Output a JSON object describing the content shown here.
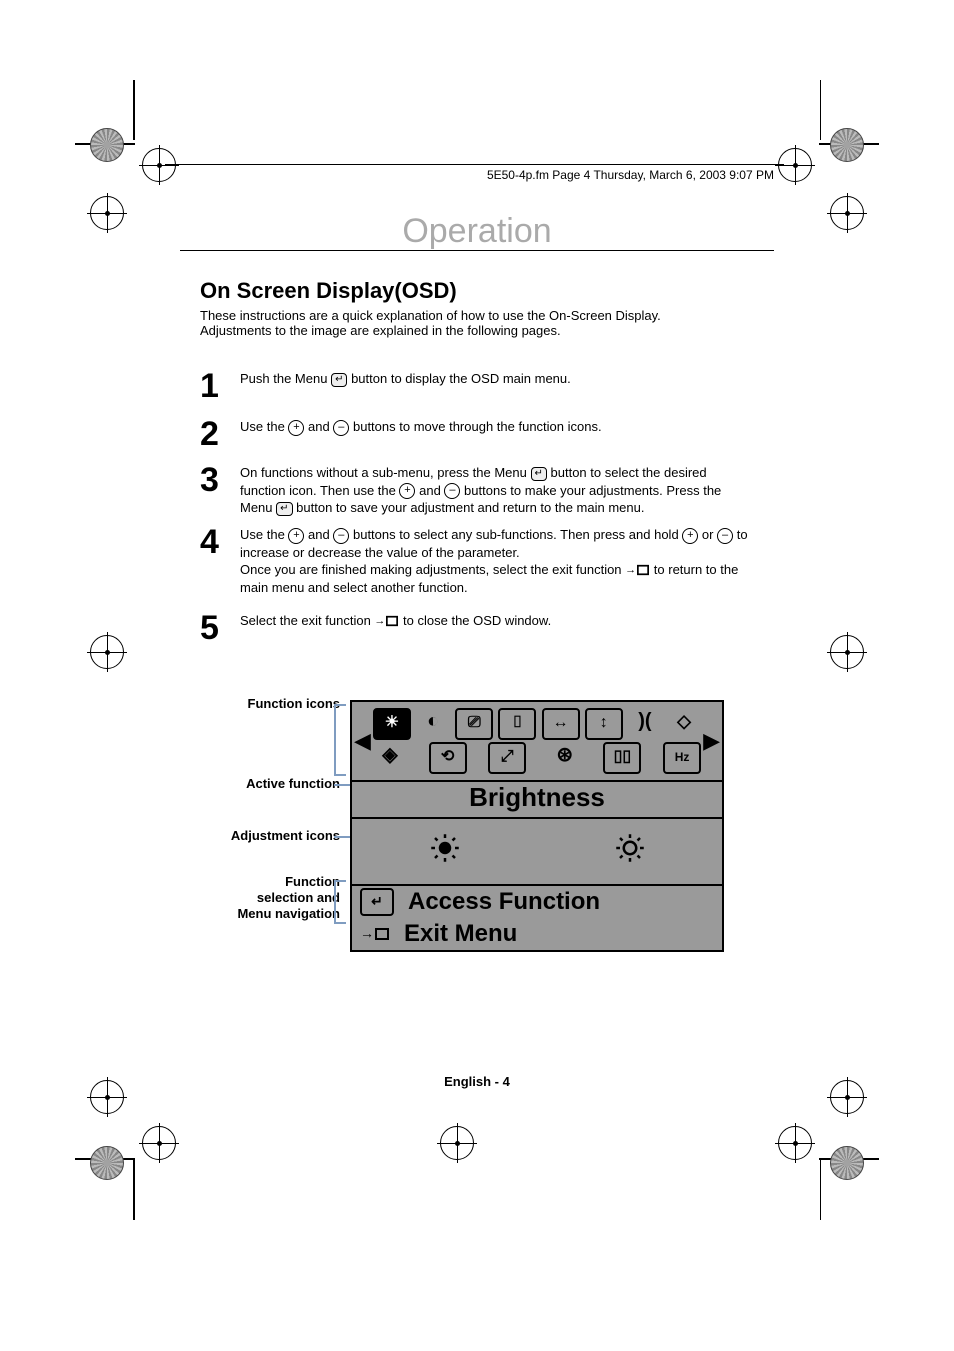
{
  "header_line": "5E50-4p.fm  Page 4  Thursday, March 6, 2003  9:07 PM",
  "section_title": "Operation",
  "page_title": "On Screen Display(OSD)",
  "intro": "These instructions are a quick explanation of how to use the On-Screen Display. Adjustments to the image are explained in the following pages.",
  "steps": {
    "s1": {
      "num": "1",
      "before": "Push the Menu ",
      "after": " button to display the OSD main menu."
    },
    "s2": {
      "num": "2",
      "before": "Use the ",
      "mid": " and ",
      "after": " buttons to move through the function icons."
    },
    "s3": {
      "num": "3",
      "line1_a": "On functions without a sub-menu, press the Menu ",
      "line1_b": " button to select the desired function icon. Then use the ",
      "line1_c": " and ",
      "line1_d": " buttons to make your adjustments. Press the Menu ",
      "line1_e": " button to save your adjustment and return to the main menu."
    },
    "s4": {
      "num": "4",
      "a": "Use the ",
      "b": " and ",
      "c": " buttons to select any sub-functions. Then press and hold ",
      "d": " or ",
      "e": " to increase or decrease the value of the parameter.",
      "post": "Once you are finished making adjustments, select the exit function ",
      "post2": " to return to the main menu and select another function."
    },
    "s5": {
      "num": "5",
      "a": "Select the exit function ",
      "b": " to close the OSD window."
    }
  },
  "labels": {
    "function_icons": "Function icons",
    "active_function": "Active function",
    "adjustment_icons": "Adjustment icons",
    "nav1": "Function",
    "nav2": "selection and",
    "nav3": "Menu navigation"
  },
  "osd": {
    "active_function": "Brightness",
    "access_function": "Access Function",
    "exit_menu": "Exit Menu",
    "hz": "Hz"
  },
  "footer": "English - 4"
}
